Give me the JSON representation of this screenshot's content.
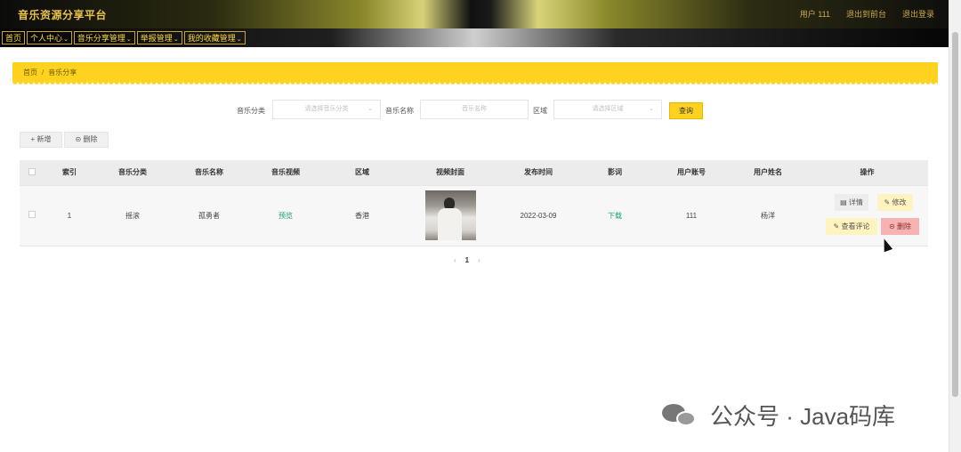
{
  "header": {
    "title": "音乐资源分享平台",
    "user_label": "用户 111",
    "exit_label": "退出到前台",
    "logout_label": "退出登录"
  },
  "nav": {
    "items": [
      {
        "label": "首页",
        "dropdown": false
      },
      {
        "label": "个人中心",
        "dropdown": true
      },
      {
        "label": "音乐分享管理",
        "dropdown": true
      },
      {
        "label": "举报管理",
        "dropdown": true
      },
      {
        "label": "我的收藏管理",
        "dropdown": true
      }
    ]
  },
  "breadcrumb": {
    "home": "首页",
    "separator": "/",
    "current": "音乐分享"
  },
  "search": {
    "category_label": "音乐分类",
    "category_placeholder": "请选择音乐分类",
    "name_label": "音乐名称",
    "name_placeholder": "音乐名称",
    "region_label": "区域",
    "region_placeholder": "请选择区域",
    "query_button": "查询"
  },
  "actions": {
    "add_label": "+ 新增",
    "delete_label": "⊝ 删除"
  },
  "table": {
    "columns": [
      "",
      "索引",
      "音乐分类",
      "音乐名称",
      "音乐视频",
      "区域",
      "视频封面",
      "发布时间",
      "影词",
      "用户账号",
      "用户姓名",
      "操作"
    ],
    "rows": [
      {
        "index": "1",
        "category": "摇滚",
        "name": "孤勇者",
        "video": "预览",
        "region": "香港",
        "publish_time": "2022-03-09",
        "lyrics": "下载",
        "account": "111",
        "username": "杨洋",
        "ops": {
          "detail": "详情",
          "edit": "修改",
          "review": "查看评论",
          "remove": "删除"
        }
      }
    ]
  },
  "pager": {
    "prev": "‹",
    "current": "1",
    "next": "›"
  },
  "watermark": {
    "text": "公众号 · Java码库"
  },
  "colors": {
    "accent": "#ffd21f",
    "nav_text": "#ffd93c",
    "link_green": "#17a36b",
    "danger": "#f7b2b2"
  }
}
